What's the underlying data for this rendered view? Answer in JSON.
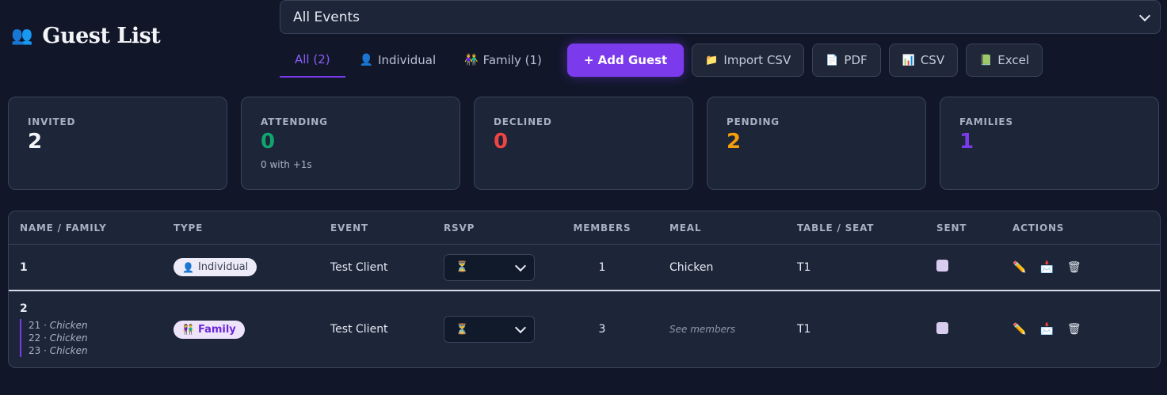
{
  "header": {
    "title_icon": "👥",
    "title": "Guest List",
    "event_select": {
      "value": "All Events"
    }
  },
  "tabs": [
    {
      "label": "All (2)",
      "icon": ""
    },
    {
      "label": "Individual",
      "icon": "👤"
    },
    {
      "label": "Family (1)",
      "icon": "👫"
    }
  ],
  "buttons": {
    "add_guest": "+ Add Guest",
    "import_csv": {
      "icon": "📁",
      "label": "Import CSV"
    },
    "pdf": {
      "icon": "📄",
      "label": "PDF"
    },
    "csv": {
      "icon": "📊",
      "label": "CSV"
    },
    "excel": {
      "icon": "📗",
      "label": "Excel"
    }
  },
  "stats": [
    {
      "label": "INVITED",
      "value": "2",
      "color": "#f3f4f8",
      "sub": ""
    },
    {
      "label": "ATTENDING",
      "value": "0",
      "color": "#10a56d",
      "sub": "0 with +1s"
    },
    {
      "label": "DECLINED",
      "value": "0",
      "color": "#ef4444",
      "sub": ""
    },
    {
      "label": "PENDING",
      "value": "2",
      "color": "#f59e0b",
      "sub": ""
    },
    {
      "label": "FAMILIES",
      "value": "1",
      "color": "#7c3aed",
      "sub": ""
    }
  ],
  "table": {
    "headers": [
      "NAME / FAMILY",
      "TYPE",
      "EVENT",
      "RSVP",
      "MEMBERS",
      "MEAL",
      "TABLE / SEAT",
      "SENT",
      "ACTIONS"
    ],
    "rows": [
      {
        "name": "1",
        "members_detail": [],
        "type": "Individual",
        "type_icon": "👤",
        "event": "Test Client",
        "rsvp_icon": "⏳",
        "members": "1",
        "meal": "Chicken",
        "table_seat": "T1",
        "actions": [
          "✏️",
          "📩",
          "🗑"
        ]
      },
      {
        "name": "2",
        "members_detail": [
          {
            "num": "21",
            "meal": "Chicken"
          },
          {
            "num": "22",
            "meal": "Chicken"
          },
          {
            "num": "23",
            "meal": "Chicken"
          }
        ],
        "type": "Family",
        "type_icon": "👫",
        "event": "Test Client",
        "rsvp_icon": "⏳",
        "members": "3",
        "meal": "See members",
        "table_seat": "T1",
        "actions": [
          "✏️",
          "📩",
          "🗑"
        ]
      }
    ]
  },
  "colors": {
    "accent": "#7c3aed",
    "background": "#111729",
    "card": "#1d2538"
  }
}
